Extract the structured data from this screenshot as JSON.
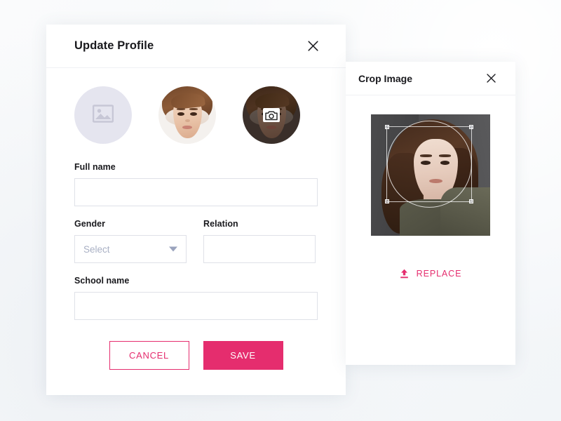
{
  "theme": {
    "accent": "#e52d6e",
    "page_background": "#f6f8fa",
    "card_background": "#ffffff",
    "label_color": "#19191d",
    "placeholder_color": "#a9b0c4",
    "input_border": "#dfe1e8",
    "avatar_placeholder_fill": "#e5e5ef"
  },
  "modal": {
    "title": "Update Profile",
    "close_icon": "close-icon",
    "avatars": [
      {
        "id": "avatar-placeholder",
        "type": "placeholder",
        "icon": "image-placeholder-icon",
        "label": ""
      },
      {
        "id": "avatar-photo-1",
        "type": "photo",
        "icon": "",
        "label": ""
      },
      {
        "id": "avatar-photo-2",
        "type": "photo-selected",
        "icon": "camera-icon",
        "label": ""
      }
    ],
    "fields": {
      "full_name": {
        "label": "Full name",
        "value": "",
        "placeholder": ""
      },
      "gender": {
        "label": "Gender",
        "value": "Select",
        "placeholder": "Select",
        "arrow_icon": "chevron-down-icon"
      },
      "relation": {
        "label": "Relation",
        "value": "",
        "placeholder": ""
      },
      "school_name": {
        "label": "School name",
        "value": "",
        "placeholder": ""
      }
    },
    "buttons": {
      "cancel": "CANCEL",
      "save": "SAVE"
    }
  },
  "crop_panel": {
    "title": "Crop Image",
    "close_icon": "close-icon",
    "replace": {
      "label": "REPLACE",
      "icon": "upload-icon"
    },
    "selection": {
      "shape": "rectangle-with-circle-guide",
      "handles": 4
    }
  }
}
